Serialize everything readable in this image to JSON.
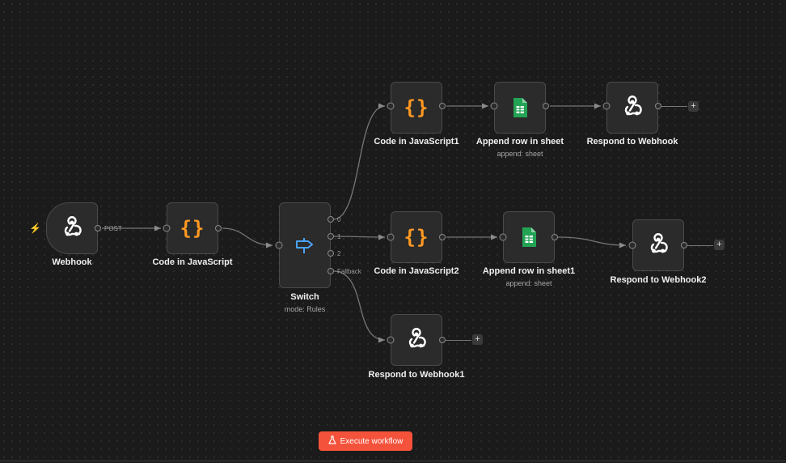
{
  "canvas": {
    "execute_button_label": "Execute workflow",
    "execute_button_icon": "flask-icon",
    "trigger_indicator_icon": "bolt-icon",
    "accent_color": "#f4523b"
  },
  "nodes": {
    "webhook": {
      "name": "Webhook",
      "icon": "webhook-icon",
      "output_label": "POST"
    },
    "code": {
      "name": "Code in JavaScript",
      "icon": "code-braces-icon"
    },
    "switch": {
      "name": "Switch",
      "subtitle": "mode: Rules",
      "icon": "signpost-icon",
      "outputs": [
        "0",
        "1",
        "2",
        "Fallback"
      ]
    },
    "code1": {
      "name": "Code in JavaScript1",
      "icon": "code-braces-icon"
    },
    "sheet": {
      "name": "Append row in sheet",
      "subtitle": "append: sheet",
      "icon": "google-sheets-icon"
    },
    "respond": {
      "name": "Respond to Webhook",
      "icon": "webhook-icon"
    },
    "code2": {
      "name": "Code in JavaScript2",
      "icon": "code-braces-icon"
    },
    "sheet1": {
      "name": "Append row in sheet1",
      "subtitle": "append: sheet",
      "icon": "google-sheets-icon"
    },
    "respond2": {
      "name": "Respond to Webhook2",
      "icon": "webhook-icon"
    },
    "respond1": {
      "name": "Respond to Webhook1",
      "icon": "webhook-icon"
    }
  },
  "add_node_label": "+"
}
